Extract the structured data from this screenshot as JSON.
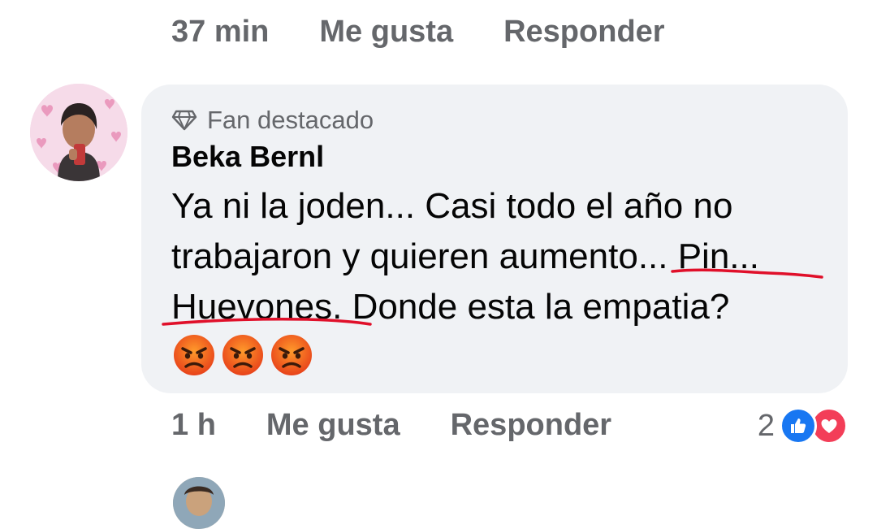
{
  "prev_comment": {
    "time": "37 min",
    "like_label": "Me gusta",
    "reply_label": "Responder"
  },
  "comment": {
    "badge": "Fan destacado",
    "author": "Beka Bernl",
    "text": "Ya ni la joden... Casi todo el año no trabajaron y quieren aumento... Pin... Huevones. Donde esta la empatia?",
    "emojis": [
      "angry-face",
      "angry-face",
      "angry-face"
    ],
    "time": "1 h",
    "like_label": "Me gusta",
    "reply_label": "Responder",
    "reaction_count": "2",
    "reaction_icons": [
      "like-icon",
      "love-icon"
    ]
  },
  "colors": {
    "bubble": "#f0f2f5",
    "meta_text": "#65676b",
    "like": "#1877f2",
    "love": "#f33e58",
    "underline": "#e0102a"
  }
}
